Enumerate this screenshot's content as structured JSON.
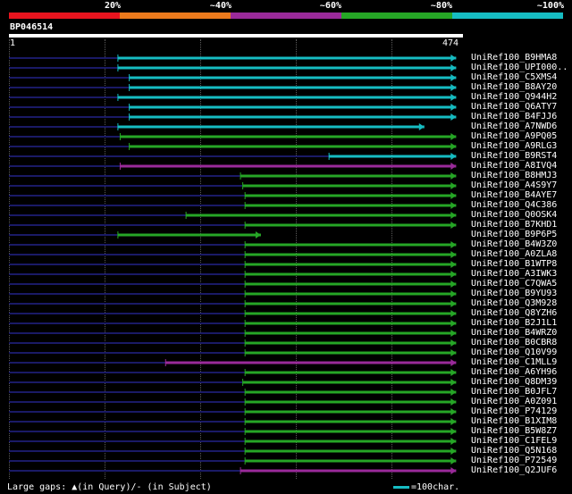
{
  "header": {
    "percentages": [
      "20%",
      "~40%",
      "~60%",
      "~80%",
      "~100%"
    ],
    "colors": [
      "#e8141e",
      "#ec7a1c",
      "#9a2a9a",
      "#26a626",
      "#16bcc2"
    ]
  },
  "query": {
    "name": "BP046514",
    "start": "1",
    "end": "474"
  },
  "hits": [
    {
      "name": "UniRef100_B9HMA8",
      "color": "#16bcc2",
      "start": 0.24,
      "end": 0.985,
      "arrow": "end"
    },
    {
      "name": "UniRef100_UPI000..",
      "color": "#16bcc2",
      "start": 0.24,
      "end": 0.985,
      "arrow": "end"
    },
    {
      "name": "UniRef100_C5XMS4",
      "color": "#16bcc2",
      "start": 0.265,
      "end": 0.985,
      "arrow": "end"
    },
    {
      "name": "UniRef100_B8AY20",
      "color": "#16bcc2",
      "start": 0.265,
      "end": 0.985,
      "arrow": "end"
    },
    {
      "name": "UniRef100_Q944H2",
      "color": "#16bcc2",
      "start": 0.24,
      "end": 0.985,
      "arrow": "end"
    },
    {
      "name": "UniRef100_Q6ATY7",
      "color": "#16bcc2",
      "start": 0.265,
      "end": 0.985,
      "arrow": "end"
    },
    {
      "name": "UniRef100_B4FJJ6",
      "color": "#16bcc2",
      "start": 0.265,
      "end": 0.985,
      "arrow": "end"
    },
    {
      "name": "UniRef100_A7NWD6",
      "color": "#16bcc2",
      "start": 0.24,
      "end": 0.915,
      "arrow": "end"
    },
    {
      "name": "UniRef100_A9PQ05",
      "color": "#26a626",
      "start": 0.245,
      "end": 0.985,
      "arrow": "end"
    },
    {
      "name": "UniRef100_A9RLG3",
      "color": "#26a626",
      "start": 0.265,
      "end": 0.985,
      "arrow": "end"
    },
    {
      "name": "UniRef100_B9RST4",
      "color": "#16bcc2",
      "start": 0.705,
      "end": 0.985,
      "arrow": "end"
    },
    {
      "name": "UniRef100_A8IVQ4",
      "color": "#9a2a9a",
      "start": 0.245,
      "end": 0.985,
      "arrow": "end"
    },
    {
      "name": "UniRef100_B8HMJ3",
      "color": "#26a626",
      "start": 0.51,
      "end": 0.985,
      "arrow": "end"
    },
    {
      "name": "UniRef100_A4S9Y7",
      "color": "#26a626",
      "start": 0.515,
      "end": 0.985,
      "arrow": "end"
    },
    {
      "name": "UniRef100_B4AYE7",
      "color": "#26a626",
      "start": 0.52,
      "end": 0.985,
      "arrow": "end"
    },
    {
      "name": "UniRef100_Q4C386",
      "color": "#26a626",
      "start": 0.52,
      "end": 0.985,
      "arrow": "end"
    },
    {
      "name": "UniRef100_Q0OSK4",
      "color": "#26a626",
      "start": 0.39,
      "end": 0.985,
      "arrow": "end"
    },
    {
      "name": "UniRef100_B7KHD1",
      "color": "#26a626",
      "start": 0.52,
      "end": 0.985,
      "arrow": "end"
    },
    {
      "name": "UniRef100_B9P6P5",
      "color": "#26a626",
      "start": 0.24,
      "end": 0.555,
      "arrow": "end"
    },
    {
      "name": "UniRef100_B4W3Z0",
      "color": "#26a626",
      "start": 0.52,
      "end": 0.985,
      "arrow": "end"
    },
    {
      "name": "UniRef100_A0ZLA8",
      "color": "#26a626",
      "start": 0.52,
      "end": 0.985,
      "arrow": "end"
    },
    {
      "name": "UniRef100_B1WTP8",
      "color": "#26a626",
      "start": 0.52,
      "end": 0.985,
      "arrow": "end"
    },
    {
      "name": "UniRef100_A3IWK3",
      "color": "#26a626",
      "start": 0.52,
      "end": 0.985,
      "arrow": "end"
    },
    {
      "name": "UniRef100_C7QWA5",
      "color": "#26a626",
      "start": 0.52,
      "end": 0.985,
      "arrow": "end"
    },
    {
      "name": "UniRef100_B9YU93",
      "color": "#26a626",
      "start": 0.52,
      "end": 0.985,
      "arrow": "end"
    },
    {
      "name": "UniRef100_Q3M928",
      "color": "#26a626",
      "start": 0.52,
      "end": 0.985,
      "arrow": "end"
    },
    {
      "name": "UniRef100_Q8YZH6",
      "color": "#26a626",
      "start": 0.52,
      "end": 0.985,
      "arrow": "end"
    },
    {
      "name": "UniRef100_B2J1L1",
      "color": "#26a626",
      "start": 0.52,
      "end": 0.985,
      "arrow": "end"
    },
    {
      "name": "UniRef100_B4WRZ0",
      "color": "#26a626",
      "start": 0.52,
      "end": 0.985,
      "arrow": "end"
    },
    {
      "name": "UniRef100_B0CBR8",
      "color": "#26a626",
      "start": 0.52,
      "end": 0.985,
      "arrow": "end"
    },
    {
      "name": "UniRef100_Q10V99",
      "color": "#26a626",
      "start": 0.52,
      "end": 0.985,
      "arrow": "end"
    },
    {
      "name": "UniRef100_C1MLL9",
      "color": "#9a2a9a",
      "start": 0.345,
      "end": 0.985,
      "arrow": "end"
    },
    {
      "name": "UniRef100_A6YH96",
      "color": "#26a626",
      "start": 0.52,
      "end": 0.985,
      "arrow": "end"
    },
    {
      "name": "UniRef100_Q8DM39",
      "color": "#26a626",
      "start": 0.515,
      "end": 0.985,
      "arrow": "end"
    },
    {
      "name": "UniRef100_B0JFL7",
      "color": "#26a626",
      "start": 0.52,
      "end": 0.985,
      "arrow": "end"
    },
    {
      "name": "UniRef100_A0Z091",
      "color": "#26a626",
      "start": 0.52,
      "end": 0.985,
      "arrow": "end"
    },
    {
      "name": "UniRef100_P74129",
      "color": "#26a626",
      "start": 0.52,
      "end": 0.985,
      "arrow": "end"
    },
    {
      "name": "UniRef100_B1XIM8",
      "color": "#26a626",
      "start": 0.52,
      "end": 0.985,
      "arrow": "end"
    },
    {
      "name": "UniRef100_B5W8Z7",
      "color": "#26a626",
      "start": 0.52,
      "end": 0.985,
      "arrow": "end"
    },
    {
      "name": "UniRef100_C1FEL9",
      "color": "#26a626",
      "start": 0.52,
      "end": 0.985,
      "arrow": "end"
    },
    {
      "name": "UniRef100_Q5N168",
      "color": "#26a626",
      "start": 0.52,
      "end": 0.985,
      "arrow": "end"
    },
    {
      "name": "UniRef100_P72549",
      "color": "#26a626",
      "start": 0.52,
      "end": 0.985,
      "arrow": "end"
    },
    {
      "name": "UniRef100_Q2JUF6",
      "color": "#9a2a9a",
      "start": 0.51,
      "end": 0.985,
      "arrow": "end"
    }
  ],
  "footer": {
    "gaps_text": "Large gaps: ▲(in Query)/‐ (in Subject)",
    "legend_text": "=100char.",
    "legend_color": "#16bcc2"
  }
}
